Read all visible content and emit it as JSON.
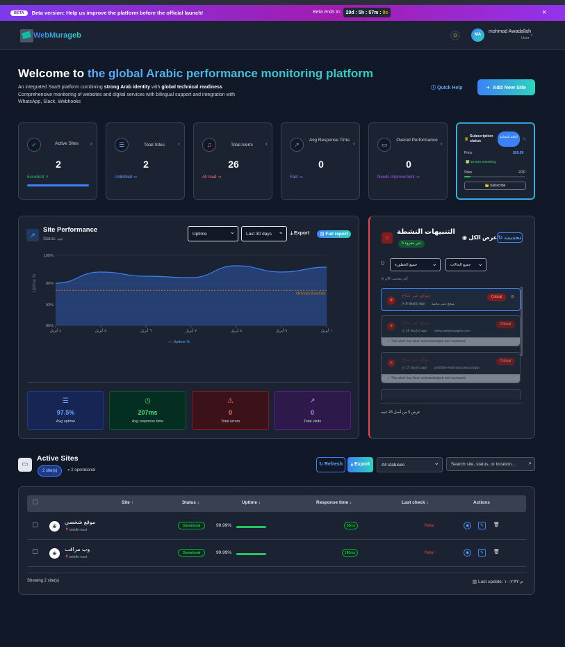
{
  "beta": {
    "tag": "BETA",
    "message": "Beta version: Help us improve the platform before the official launch!",
    "ends_label": "Beta ends in:",
    "days": "20d",
    "hours": "5h",
    "minutes": "57m",
    "seconds": "9s",
    "close": "×"
  },
  "nav": {
    "brand": "WebMurageb",
    "user_initials": "MA",
    "user_name": "mohmad Awadallah",
    "user_role": "User"
  },
  "hero": {
    "title_plain": "Welcome to ",
    "title_accent": "the global Arabic performance monitoring platform",
    "desc_1": "An integrated SaaS platform combining ",
    "desc_b1": "strong Arab identity",
    "desc_2": " with ",
    "desc_b2": "global technical readiness",
    "desc_3": "Comprehensive monitoring of websites and digital services with bilingual support and integration with WhatsApp, Slack, Webhooks",
    "quick_help": "Quick Help",
    "add_site": "Add New Site"
  },
  "cards": [
    {
      "label": "Active Sites",
      "value": "2",
      "status": "Excellent ↗",
      "status_color": "#22c55e",
      "icon": "check-circle-icon",
      "icon_color": "#22c55e",
      "progress": 1.0
    },
    {
      "label": "Total Sites",
      "value": "2",
      "status": "Unlimited ↝",
      "status_color": "#60a5fa",
      "icon": "server-icon",
      "icon_color": "#60a5fa"
    },
    {
      "label": "Total Alerts",
      "value": "26",
      "status": "All read ↝",
      "status_color": "#f87171",
      "icon": "bell-icon",
      "icon_color": "#f87171"
    },
    {
      "label": "Avg Response Time",
      "value": "0",
      "status": "Fast ↝",
      "status_color": "#818cf8",
      "icon": "trend-icon",
      "icon_color": "#60a5fa"
    },
    {
      "label": "Overall Performance",
      "value": "0",
      "status": "Needs improvement ↝",
      "status_color": "#a855f7",
      "icon": "monitor-icon",
      "icon_color": "#a78bfa"
    }
  ],
  "subscription": {
    "title": "Subscription status",
    "plan": "الباقة المجانية",
    "price_label": "Price",
    "price": "$26.99",
    "remaining": "✅ 18 sites remaining",
    "sites_label": "Sites",
    "sites_value": "2/20",
    "sites_fraction": 0.1,
    "subscribe": "👑 Subscribe"
  },
  "performance": {
    "title": "Site Performance",
    "status": "Status: جيد",
    "metric_select": "Uptime",
    "range_select": "Last 30 days",
    "export": "Export",
    "full_report": "Full report",
    "threshold_label": "Minimum threshold",
    "legend": "Uptime %",
    "stats": [
      {
        "value": "97.5%",
        "label": "Avg uptime",
        "color": "#60a5fa"
      },
      {
        "value": "207ms",
        "label": "Avg response time",
        "color": "#4ade80"
      },
      {
        "value": "0",
        "label": "Total errors",
        "color": "#f87171"
      },
      {
        "value": "0",
        "label": "Total visits",
        "color": "#c084fc"
      }
    ]
  },
  "chart_data": {
    "type": "area",
    "title": "",
    "xlabel": "",
    "ylabel": "Uptime %",
    "x": [
      "٤ أبريل",
      "٥ أبريل",
      "٦ أبريل",
      "٧ أبريل",
      "٨ أبريل",
      "٩ أبريل",
      "١ أبريل"
    ],
    "series": [
      {
        "name": "Uptime %",
        "values": [
          96.0,
          97.6,
          97.0,
          96.8,
          98.5,
          97.6,
          98.3
        ]
      }
    ],
    "y_ticks": [
      "80%",
      "93%",
      "96%",
      "100%"
    ],
    "threshold": 95,
    "grid": true
  },
  "alerts": {
    "title": "التنبيهات النشطة",
    "unread": "غير مقروء 5",
    "view_all": "عرض الكل",
    "refresh": "تحديث",
    "severity_select": "جميع الخطورة",
    "status_select": "جميع الحالات",
    "last_update": "آخر تحديث: الآن",
    "items": [
      {
        "title": "موقع غير متاح",
        "time": "8 day(s) ago",
        "site": "موقع عمر محمد",
        "badge": "Critical",
        "ack": ""
      },
      {
        "title": "موقع غير متاح",
        "time": "15 day(s) ago",
        "site": "www.webmurageb.com",
        "badge": "Critical",
        "ack": "This alert has been acknowledged and reviewed"
      },
      {
        "title": "موقع غير متاح",
        "time": "17 day(s) ago",
        "site": "portfolio-mohmad.sencal.app",
        "badge": "Critical",
        "ack": "This alert has been acknowledged and reviewed"
      }
    ],
    "footer": "عرض 5 من أصل 26 تنبيه"
  },
  "sites": {
    "title": "Active Sites",
    "count": "2 site(s)",
    "operational": "2 operational",
    "refresh": "Refresh",
    "export": "Export",
    "status_filter": "All statuses",
    "search_placeholder": "Search site, status, or location...",
    "columns": {
      "site": "Site ↑",
      "status": "Status ↓",
      "uptime": "Uptime ↓",
      "response": "Response time ↓",
      "last_check": "Last check ↓",
      "actions": "Actions"
    },
    "rows": [
      {
        "name": "موقع شخصي",
        "region": "middle-east",
        "status": "Operational",
        "uptime": "99.99%",
        "uptime_fraction": 0.9999,
        "response": "65ms",
        "last_check": "Now"
      },
      {
        "name": "وب مراقب",
        "region": "middle-east",
        "status": "Operational",
        "uptime": "99.99%",
        "uptime_fraction": 0.9999,
        "response": "180ms",
        "last_check": "Now"
      }
    ],
    "showing": "Showing 2 site(s)",
    "last_update": "Last update: م ١٠:٢:٣٢"
  }
}
